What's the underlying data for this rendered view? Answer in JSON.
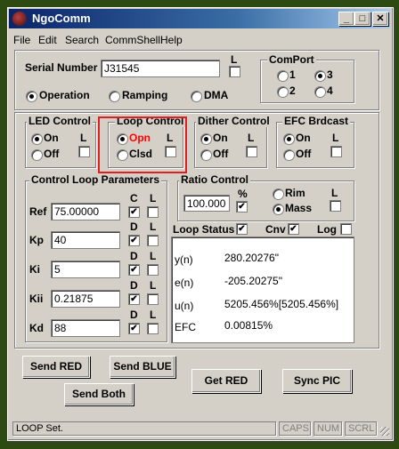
{
  "window": {
    "title": "NgoComm",
    "min_label": "_",
    "max_label": "□",
    "close_label": "✕"
  },
  "menu": [
    "File",
    "Edit",
    "Search",
    "CommShell",
    "Help"
  ],
  "serial": {
    "label": "Serial Number",
    "value": "J31545",
    "l_label": "L"
  },
  "mode": {
    "operation": "Operation",
    "ramping": "Ramping",
    "dma": "DMA",
    "selected": "Operation"
  },
  "comport": {
    "title": "ComPort",
    "options": [
      "1",
      "3",
      "2",
      "4"
    ],
    "selected": "3"
  },
  "led": {
    "title": "LED Control",
    "on": "On",
    "off": "Off",
    "l": "L"
  },
  "loop": {
    "title": "Loop Control",
    "opn": "Opn",
    "clsd": "Clsd",
    "l": "L",
    "accent": "#ff0000"
  },
  "dither": {
    "title": "Dither Control",
    "on": "On",
    "off": "Off",
    "l": "L"
  },
  "efc": {
    "title": "EFC Brdcast",
    "on": "On",
    "off": "Off",
    "l": "L"
  },
  "params": {
    "title": "Control Loop Parameters",
    "rows": [
      {
        "name": "Ref",
        "value": "75.00000",
        "col": "C",
        "l": "L"
      },
      {
        "name": "Kp",
        "value": "40",
        "col": "D",
        "l": "L"
      },
      {
        "name": "Ki",
        "value": "5",
        "col": "D",
        "l": "L"
      },
      {
        "name": "Kii",
        "value": "0.21875",
        "col": "D",
        "l": "L"
      },
      {
        "name": "Kd",
        "value": "88",
        "col": "D",
        "l": "L"
      }
    ]
  },
  "ratio": {
    "title": "Ratio Control",
    "value": "100.000",
    "percent": "%",
    "rim": "Rim",
    "mass": "Mass",
    "l": "L"
  },
  "loop_status": {
    "title": "Loop Status",
    "cnv": "Cnv",
    "log": "Log",
    "rows": [
      {
        "name": "y(n)",
        "value": "280.20276\""
      },
      {
        "name": "e(n)",
        "value": "-205.20275\""
      },
      {
        "name": "u(n)",
        "value": "5205.456%[5205.456%]"
      },
      {
        "name": "EFC",
        "value": "0.00815%"
      }
    ]
  },
  "buttons": {
    "send_red": "Send RED",
    "send_blue": "Send BLUE",
    "send_both": "Send Both",
    "get_red": "Get RED",
    "sync_pic": "Sync PIC"
  },
  "statusbar": {
    "message": "LOOP Set.",
    "caps": "CAPS",
    "num": "NUM",
    "scrl": "SCRL"
  }
}
